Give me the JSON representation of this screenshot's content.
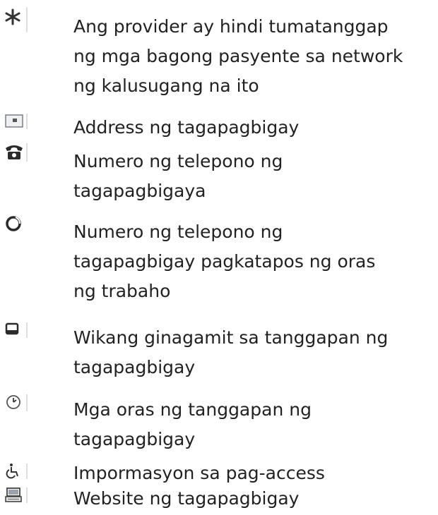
{
  "legend": {
    "items": [
      {
        "icon": "asterisk-icon",
        "lines": [
          "Ang provider ay hindi tumatanggap",
          "ng mga bagong pasyente sa network",
          "ng kalusugang na ito"
        ]
      },
      {
        "icon": "address-card-icon",
        "lines": [
          "Address ng tagapagbigay"
        ]
      },
      {
        "icon": "telephone-icon",
        "lines": [
          "Numero ng telepono ng",
          "tagapagbigaya"
        ]
      },
      {
        "icon": "after-hours-phone-icon",
        "lines": [
          "Numero ng telepono ng",
          "tagapagbigay pagkatapos ng oras",
          "ng trabaho"
        ]
      },
      {
        "icon": "speech-bubble-icon",
        "lines": [
          "Wikang ginagamit sa tanggapan ng",
          "tagapagbigay"
        ]
      },
      {
        "icon": "clock-icon",
        "lines": [
          "Mga oras ng tanggapan ng",
          "tagapagbigay"
        ]
      },
      {
        "icon": "wheelchair-icon",
        "lines": [
          "Impormasyon sa pag-access"
        ]
      },
      {
        "icon": "computer-icon",
        "lines": [
          "Website ng tagapagbigay"
        ]
      }
    ]
  }
}
